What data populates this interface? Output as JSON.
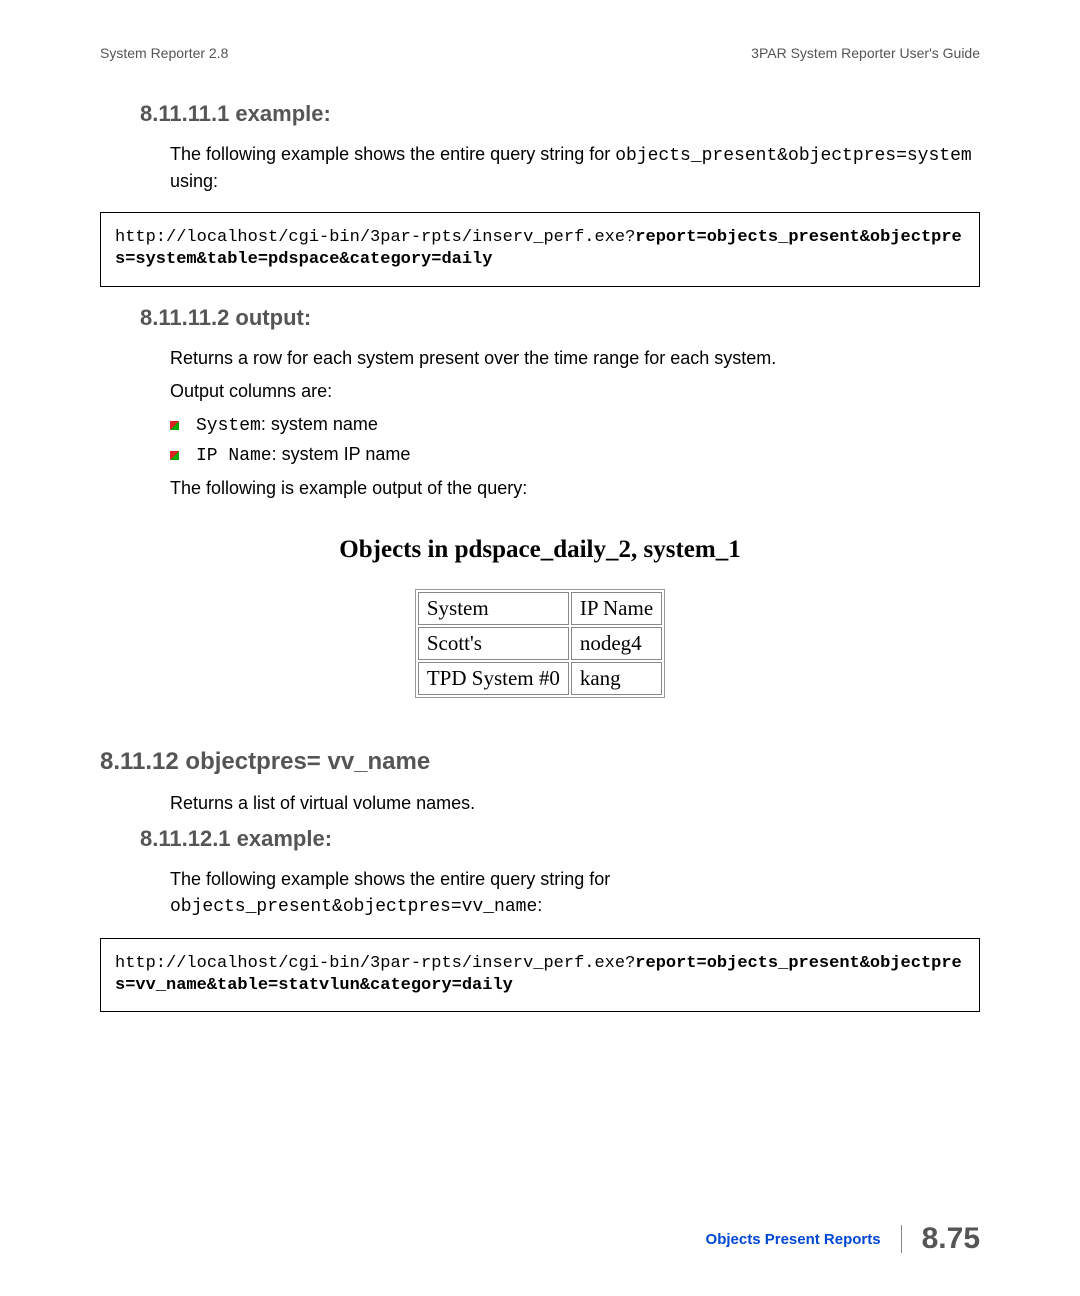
{
  "header": {
    "left": "System Reporter 2.8",
    "right": "3PAR System Reporter User's Guide"
  },
  "s1": {
    "heading": "8.11.11.1 example:",
    "intro_a": "The following example shows the entire query string for ",
    "intro_code": "objects_present&objectpres=system",
    "intro_b": " using:",
    "code_plain": "http://localhost/cgi-bin/3par-rpts/inserv_perf.exe?",
    "code_bold": "report=objects_present&objectpres=system&table=pdspace&category=daily"
  },
  "s2": {
    "heading": "8.11.11.2 output:",
    "desc": "Returns a row for each system present over the time range for each system.",
    "cols_intro": "Output columns are:",
    "bullets": [
      {
        "code": "System",
        "text": ": system name"
      },
      {
        "code": "IP Name",
        "text": ": system IP name"
      }
    ],
    "outro": "The following is example output of the query:",
    "caption": "Objects in pdspace_daily_2, system_1",
    "table": {
      "headers": [
        "System",
        "IP Name"
      ],
      "rows": [
        [
          "Scott's",
          "nodeg4"
        ],
        [
          "TPD System #0",
          "kang"
        ]
      ]
    }
  },
  "s3": {
    "heading": "8.11.12 objectpres= vv_name",
    "desc": "Returns a list of virtual volume names."
  },
  "s4": {
    "heading": "8.11.12.1 example:",
    "intro_a": "The following example shows the entire query string for ",
    "intro_code": "objects_present&objectpres=vv_name",
    "intro_b": ":",
    "code_plain": "http://localhost/cgi-bin/3par-rpts/inserv_perf.exe?",
    "code_bold": "report=objects_present&objectpres=vv_name&table=statvlun&category=daily"
  },
  "footer": {
    "label": "Objects Present Reports",
    "page": "8.75"
  }
}
